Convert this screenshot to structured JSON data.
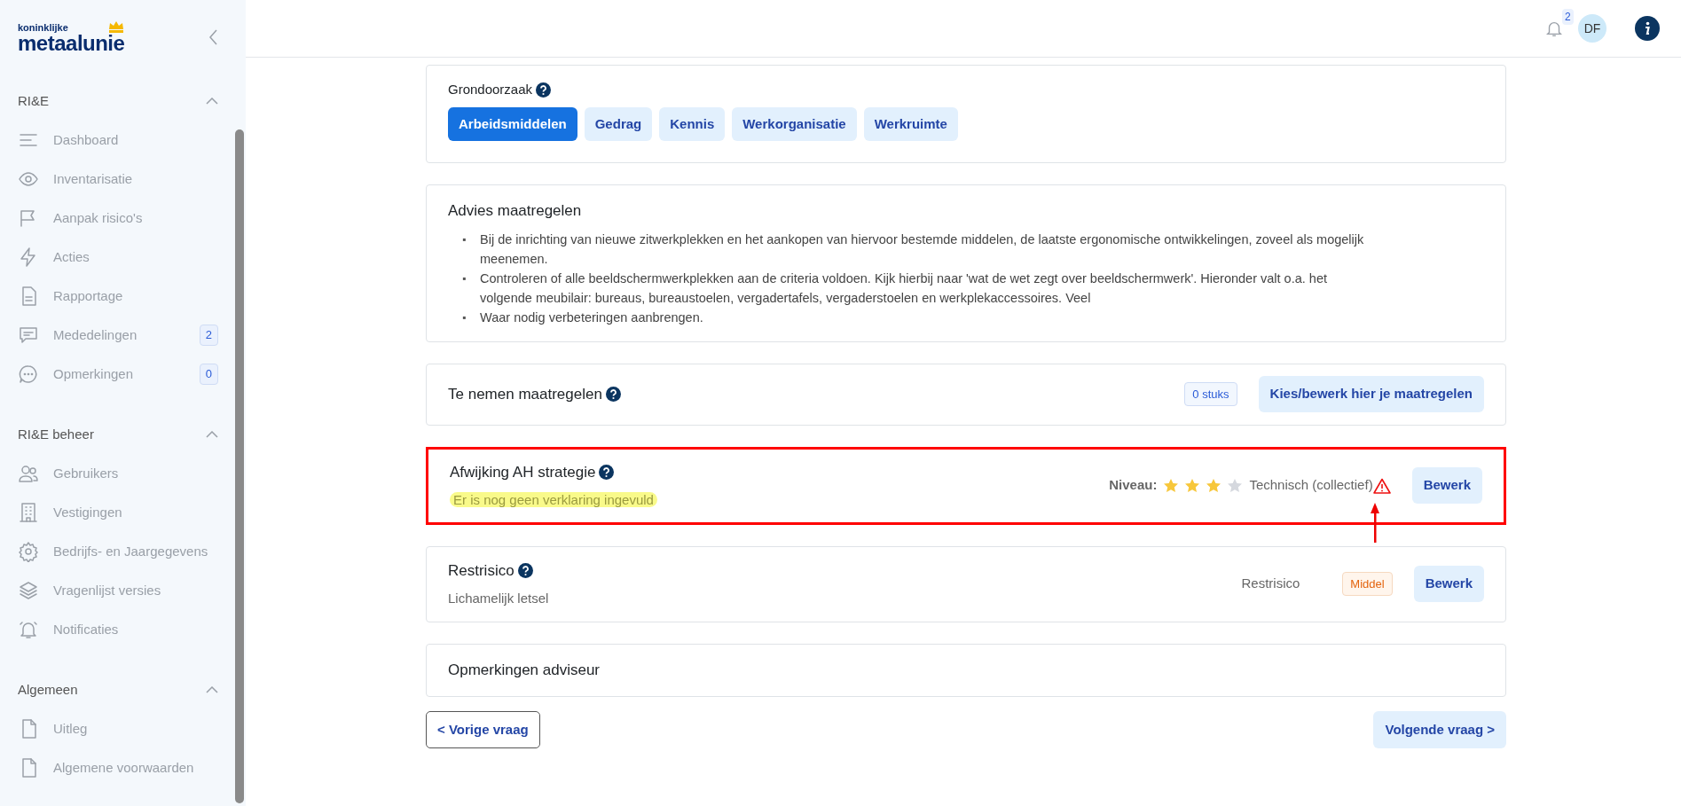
{
  "logo": {
    "small": "koninklijke",
    "big": "metaalunie"
  },
  "sidebar": {
    "sections": [
      {
        "title": "RI&E",
        "expanded": true,
        "items": [
          {
            "label": "Dashboard"
          },
          {
            "label": "Inventarisatie"
          },
          {
            "label": "Aanpak risico's"
          },
          {
            "label": "Acties"
          },
          {
            "label": "Rapportage"
          },
          {
            "label": "Mededelingen",
            "count": "2"
          },
          {
            "label": "Opmerkingen",
            "count": "0"
          }
        ]
      },
      {
        "title": "RI&E beheer",
        "expanded": true,
        "items": [
          {
            "label": "Gebruikers"
          },
          {
            "label": "Vestigingen"
          },
          {
            "label": "Bedrijfs- en Jaargegevens"
          },
          {
            "label": "Vragenlijst versies"
          },
          {
            "label": "Notificaties"
          }
        ]
      },
      {
        "title": "Algemeen",
        "expanded": true,
        "items": [
          {
            "label": "Uitleg"
          },
          {
            "label": "Algemene voorwaarden"
          }
        ]
      }
    ]
  },
  "header": {
    "notifications": "2",
    "avatar": "DF"
  },
  "grondoorzaak": {
    "title": "Grondoorzaak",
    "options": [
      {
        "label": "Arbeidsmiddelen",
        "selected": true
      },
      {
        "label": "Gedrag",
        "selected": false
      },
      {
        "label": "Kennis",
        "selected": false
      },
      {
        "label": "Werkorganisatie",
        "selected": false
      },
      {
        "label": "Werkruimte",
        "selected": false
      }
    ]
  },
  "advies": {
    "title": "Advies maatregelen",
    "items": [
      {
        "marker": "▪",
        "text": "Bij de inrichting van nieuwe zitwerkplekken en het aankopen van hiervoor bestemde middelen, de laatste ergonomische ontwikkelingen, zoveel als mogelijk meenemen."
      },
      {
        "marker": "▪",
        "text": "Controleren of alle beeldschermwerkplekken aan de criteria voldoen. Kijk hierbij naar 'wat de wet zegt over beeldschermwerk'. Hieronder valt o.a. het volgende meubilair: bureaus, bureaustoelen, vergadertafels, vergaderstoelen en werkplekaccessoires. Veel"
      },
      {
        "marker": "▪",
        "text": "Waar nodig verbeteringen aanbrengen."
      }
    ]
  },
  "maatregelen": {
    "title": "Te nemen maatregelen",
    "count": "0 stuks",
    "button": "Kies/bewerk hier je maatregelen"
  },
  "afwijking": {
    "title": "Afwijking AH strategie",
    "note": "Er is nog geen verklaring ingevuld",
    "note_highlighted": true,
    "outlined": true,
    "level_label": "Niveau:",
    "stars": 3,
    "level_text": "Technisch (collectief)",
    "warning": true,
    "arrow": true,
    "button": "Bewerk"
  },
  "restrisico": {
    "title": "Restrisico",
    "subtitle": "Lichamelijk letsel",
    "label": "Restrisico",
    "badge": "Middel",
    "button": "Bewerk"
  },
  "opmerkingen": {
    "title": "Opmerkingen adviseur"
  },
  "nav": {
    "prev": "< Vorige vraag",
    "next": "Volgende vraag >"
  }
}
